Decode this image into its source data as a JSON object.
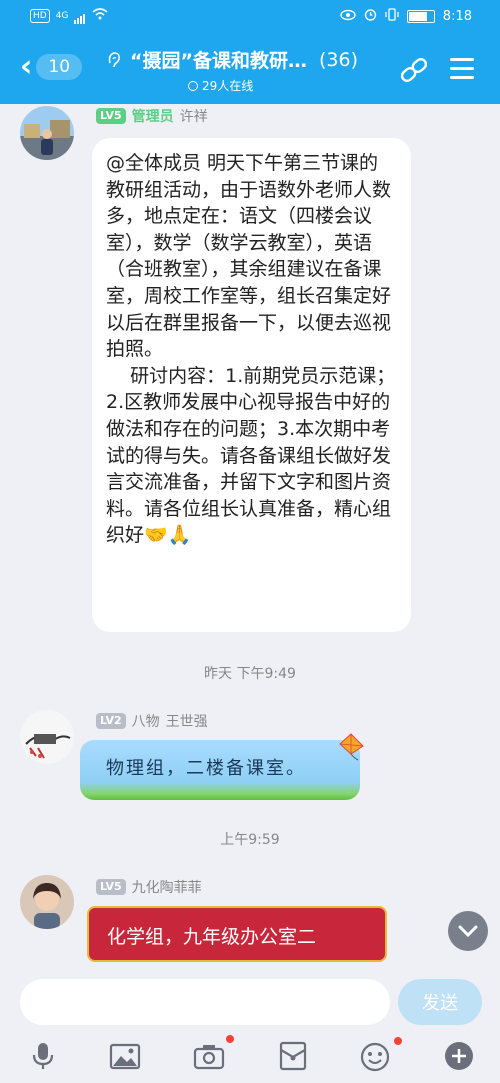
{
  "status_bar": {
    "left_items": [
      "HD",
      "4G"
    ],
    "time": "8:18"
  },
  "header": {
    "back_count": "10",
    "group_name": "“摄园”备课和教研…",
    "member_count": "(36)",
    "online_text": "29人在线"
  },
  "messages": [
    {
      "level": "LV5",
      "role": "管理员",
      "sender": "许祥",
      "paragraphs": [
        "@全体成员 明天下午第三节课的教研组活动，由于语数外老师人数多，地点定在：语文（四楼会议室），数学（数学云教室），英语（合班教室），其余组建议在备课室，周校工作室等，组长召集定好以后在群里报备一下，以便去巡视拍照。",
        "    研讨内容：1.前期党员示范课；2.区教师发展中心视导报告中好的做法和存在的问题；3.本次期中考试的得与失。请各备课组长做好发言交流准备，并留下文字和图片资料。请各位组长认真准备，精心组织好🤝🙏"
      ]
    },
    {
      "level": "LV2",
      "group_tag": "八物",
      "sender": "王世强",
      "text": "物理组，二楼备课室。"
    },
    {
      "level": "LV5",
      "sender": "九化陶菲菲",
      "text": "化学组，九年级办公室二"
    }
  ],
  "timestamps": {
    "t1": "昨天 下午9:49",
    "t2": "上午9:59"
  },
  "input_bar": {
    "placeholder": "",
    "send_label": "发送"
  },
  "colors": {
    "header_blue": "#1ea7ee",
    "bg": "#eef0f5",
    "level_green": "#5dcf84",
    "chem_red": "#c8263a"
  }
}
